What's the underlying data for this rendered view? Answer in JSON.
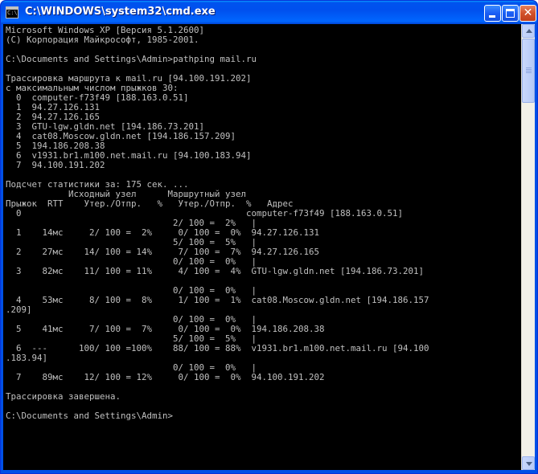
{
  "window": {
    "title": "C:\\WINDOWS\\system32\\cmd.exe",
    "app_icon_glyph": "C:\\",
    "close_glyph": "✕",
    "colors": {
      "titlebar": "#0050ee",
      "console_bg": "#000000",
      "console_text": "#c0c0c0",
      "close_button": "#d2512a"
    },
    "icons": {
      "app": "cmd-icon",
      "minimize": "minimize-icon",
      "maximize": "maximize-icon",
      "close": "close-icon",
      "scroll_up": "arrow-up-icon",
      "scroll_down": "arrow-down-icon"
    }
  },
  "console": {
    "lines": [
      "Microsoft Windows XP [Версия 5.1.2600]",
      "(С) Корпорация Майкрософт, 1985-2001.",
      "",
      "C:\\Documents and Settings\\Admin>pathping mail.ru",
      "",
      "Трассировка маршрута к mail.ru [94.100.191.202]",
      "с максимальным числом прыжков 30:",
      "  0  computer-f73f49 [188.163.0.51]",
      "  1  94.27.126.131",
      "  2  94.27.126.165",
      "  3  GTU-lgw.gldn.net [194.186.73.201]",
      "  4  cat08.Moscow.gldn.net [194.186.157.209]",
      "  5  194.186.208.38",
      "  6  v1931.br1.m100.net.mail.ru [94.100.183.94]",
      "  7  94.100.191.202",
      "",
      "Подсчет статистики за: 175 сек. ...",
      "            Исходный узел      Маршрутный узел",
      "Прыжок  RTT    Утер./Отпр.   %   Утер./Отпр.  %   Адрес",
      "  0                                           computer-f73f49 [188.163.0.51]",
      "                                2/ 100 =  2%   |",
      "  1    14мс     2/ 100 =  2%     0/ 100 =  0%  94.27.126.131",
      "                                5/ 100 =  5%   |",
      "  2    27мс    14/ 100 = 14%     7/ 100 =  7%  94.27.126.165",
      "                                0/ 100 =  0%   |",
      "  3    82мс    11/ 100 = 11%     4/ 100 =  4%  GTU-lgw.gldn.net [194.186.73.201]",
      "",
      "                                0/ 100 =  0%   |",
      "  4    53мс     8/ 100 =  8%     1/ 100 =  1%  cat08.Moscow.gldn.net [194.186.157",
      ".209]",
      "                                0/ 100 =  0%   |",
      "  5    41мс     7/ 100 =  7%     0/ 100 =  0%  194.186.208.38",
      "                                5/ 100 =  5%   |",
      "  6  ---      100/ 100 =100%    88/ 100 = 88%  v1931.br1.m100.net.mail.ru [94.100",
      ".183.94]",
      "                                0/ 100 =  0%   |",
      "  7    89мс    12/ 100 = 12%     0/ 100 =  0%  94.100.191.202",
      "",
      "Трассировка завершена.",
      "",
      "C:\\Documents and Settings\\Admin>"
    ]
  },
  "scrollbar": {
    "scroll_position": 0.0
  }
}
